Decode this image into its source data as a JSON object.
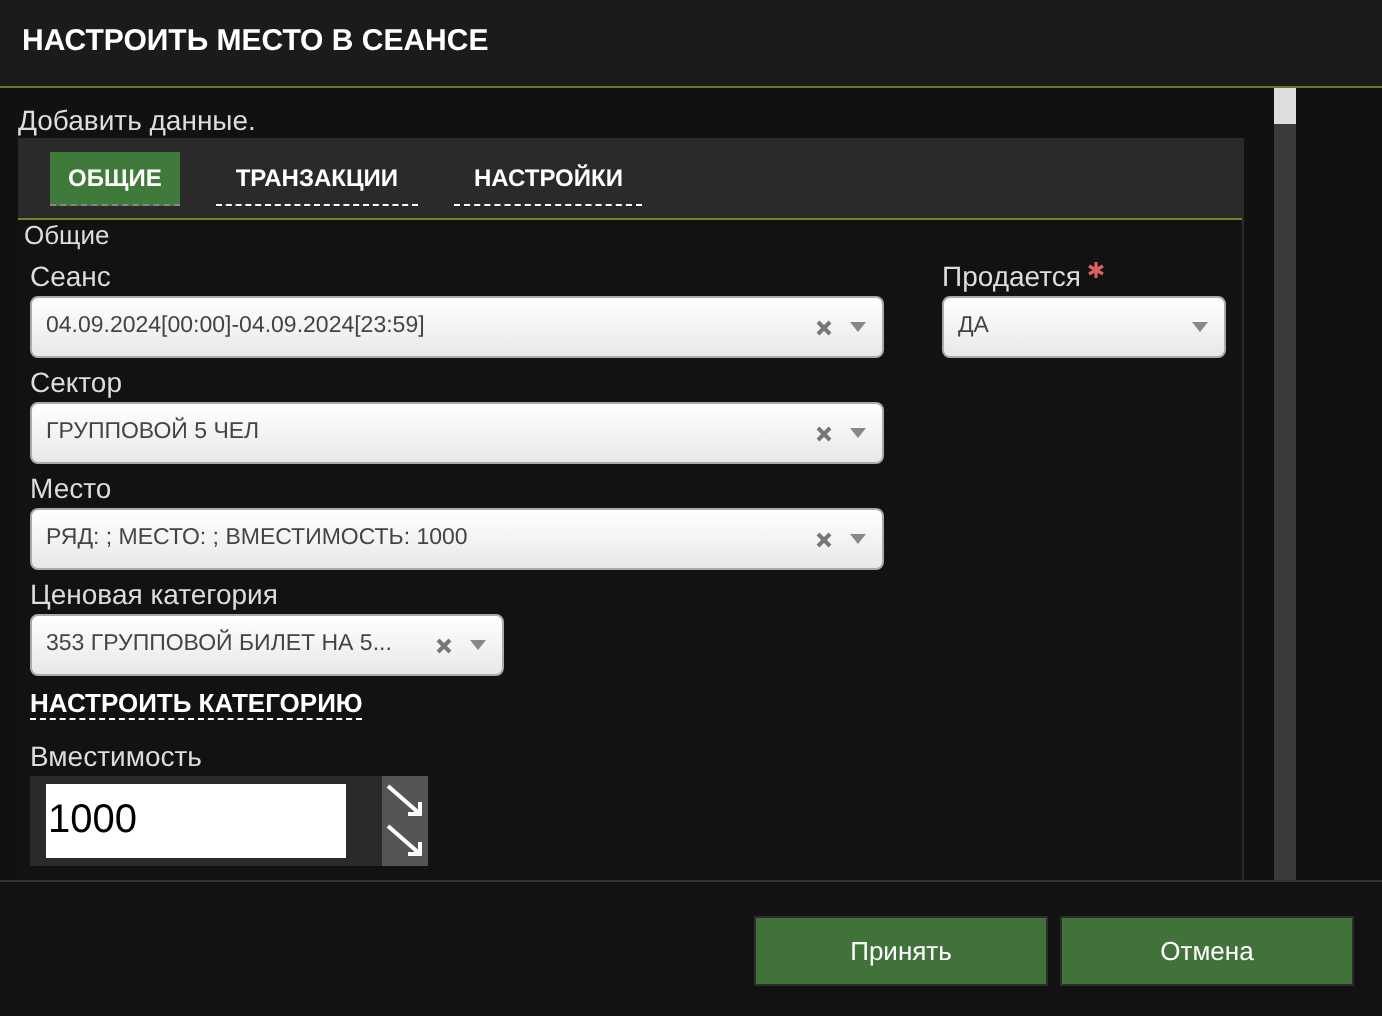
{
  "window": {
    "title": "НАСТРОИТЬ МЕСТО В СЕАНСЕ"
  },
  "subtitle": "Добавить данные.",
  "tabs": [
    {
      "label": "ОБЩИЕ",
      "selected": true
    },
    {
      "label": "ТРАНЗАКЦИИ",
      "selected": false
    },
    {
      "label": "НАСТРОЙКИ",
      "selected": false
    }
  ],
  "section_title": "Общие",
  "session": {
    "label": "Сеанс",
    "value": "04.09.2024[00:00]-04.09.2024[23:59]",
    "clearable": true,
    "required": false
  },
  "for_sale": {
    "label": "Продается",
    "value": "ДА",
    "clearable": false,
    "required": true
  },
  "sector": {
    "label": "Сектор",
    "value": "ГРУППОВОЙ 5 ЧЕЛ",
    "clearable": true,
    "required": false
  },
  "seat": {
    "label": "Место",
    "value": "РЯД: ; МЕСТО: ; ВМЕСТИМОСТЬ: 1000",
    "clearable": true,
    "required": false
  },
  "price_category": {
    "label": "Ценовая категория",
    "value": "353 ГРУППОВОЙ БИЛЕТ НА 5...",
    "clearable": true,
    "required": false
  },
  "configure_link": "НАСТРОИТЬ КАТЕГОРИЮ",
  "capacity": {
    "label": "Вместимость",
    "value": "1000"
  },
  "buttons": [
    "Принять",
    "Отмена"
  ]
}
